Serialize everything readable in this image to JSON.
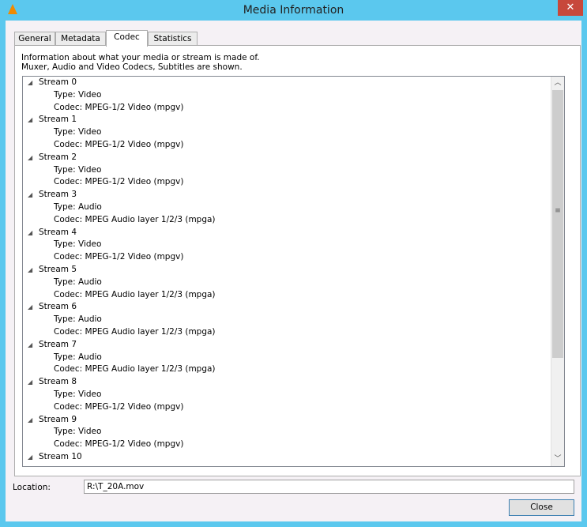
{
  "window": {
    "title": "Media Information",
    "close_glyph": "✕"
  },
  "tabs": [
    {
      "label": "General"
    },
    {
      "label": "Metadata"
    },
    {
      "label": "Codec"
    },
    {
      "label": "Statistics"
    }
  ],
  "active_tab": "Codec",
  "codec": {
    "info_line1": "Information about what your media or stream is made of.",
    "info_line2": "Muxer, Audio and Video Codecs, Subtitles are shown.",
    "streams": [
      {
        "label": "Stream 0",
        "type": "Type: Video",
        "codec": "Codec: MPEG-1/2 Video (mpgv)"
      },
      {
        "label": "Stream 1",
        "type": "Type: Video",
        "codec": "Codec: MPEG-1/2 Video (mpgv)"
      },
      {
        "label": "Stream 2",
        "type": "Type: Video",
        "codec": "Codec: MPEG-1/2 Video (mpgv)"
      },
      {
        "label": "Stream 3",
        "type": "Type: Audio",
        "codec": "Codec: MPEG Audio layer 1/2/3 (mpga)"
      },
      {
        "label": "Stream 4",
        "type": "Type: Video",
        "codec": "Codec: MPEG-1/2 Video (mpgv)"
      },
      {
        "label": "Stream 5",
        "type": "Type: Audio",
        "codec": "Codec: MPEG Audio layer 1/2/3 (mpga)"
      },
      {
        "label": "Stream 6",
        "type": "Type: Audio",
        "codec": "Codec: MPEG Audio layer 1/2/3 (mpga)"
      },
      {
        "label": "Stream 7",
        "type": "Type: Audio",
        "codec": "Codec: MPEG Audio layer 1/2/3 (mpga)"
      },
      {
        "label": "Stream 8",
        "type": "Type: Video",
        "codec": "Codec: MPEG-1/2 Video (mpgv)"
      },
      {
        "label": "Stream 9",
        "type": "Type: Video",
        "codec": "Codec: MPEG-1/2 Video (mpgv)"
      },
      {
        "label": "Stream 10"
      }
    ]
  },
  "location": {
    "label": "Location:",
    "value": "R:\\T_20A.mov"
  },
  "close_label": "Close"
}
